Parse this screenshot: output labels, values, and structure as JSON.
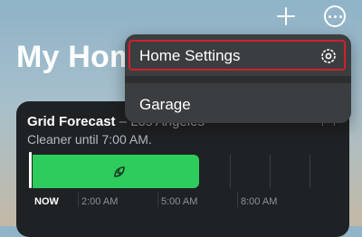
{
  "header": {
    "add_icon": "plus-icon",
    "more_icon": "ellipsis-circle-icon",
    "title": "My Home"
  },
  "menu": {
    "items": [
      {
        "label": "Home Settings",
        "icon": "gear-icon"
      },
      {
        "label": "Garage"
      }
    ],
    "highlight_color": "#d0202a"
  },
  "grid_card": {
    "title": "Grid Forecast",
    "location": "– Los Angeles",
    "subtitle": "Cleaner until 7:00 AM.",
    "clean_color": "#2ecc5d",
    "clean_icon": "leaf-bolt-icon",
    "time_labels": [
      "NOW",
      "2:00 AM",
      "5:00 AM",
      "8:00 AM"
    ],
    "clean_until": "7:00 AM"
  }
}
